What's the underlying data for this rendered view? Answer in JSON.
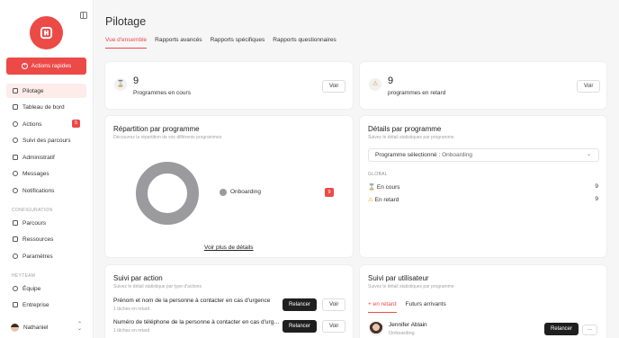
{
  "app": {
    "brand_color": "#ec4a47"
  },
  "sidebar": {
    "quick_action_label": "Actions rapides",
    "items": [
      {
        "label": "Pilotage",
        "icon": "home-icon",
        "active": true
      },
      {
        "label": "Tableau de bord",
        "icon": "dashboard-icon"
      },
      {
        "label": "Actions",
        "icon": "lightning-icon",
        "badge": "5"
      },
      {
        "label": "Suivi des parcours",
        "icon": "route-icon"
      },
      {
        "label": "Administratif",
        "icon": "folder-icon"
      },
      {
        "label": "Messages",
        "icon": "chat-icon"
      },
      {
        "label": "Notifications",
        "icon": "bell-icon"
      }
    ],
    "config_section": "CONFIGURATION",
    "config_items": [
      {
        "label": "Parcours",
        "icon": "chart-icon"
      },
      {
        "label": "Ressources",
        "icon": "database-icon"
      },
      {
        "label": "Paramètres",
        "icon": "gear-icon"
      }
    ],
    "team_section": "HEYTEAM",
    "team_items": [
      {
        "label": "Équipe",
        "icon": "user-icon"
      },
      {
        "label": "Entreprise",
        "icon": "building-icon"
      }
    ],
    "user_name": "Nathaniel"
  },
  "header": {
    "title": "Pilotage",
    "tabs": [
      "Vue d'ensemble",
      "Rapports avancés",
      "Rapports spécifiques",
      "Rapports questionnaires"
    ]
  },
  "stats": [
    {
      "value": "9",
      "label": "Programmes en cours",
      "icon": "hourglass-icon",
      "button": "Voir"
    },
    {
      "value": "9",
      "label": "programmes en retard",
      "icon": "warning-icon",
      "button": "Voir"
    }
  ],
  "repartition": {
    "title": "Répartition par programme",
    "subtitle": "Découvrez la répartition de vos différents programmes",
    "legend_label": "Onboarding",
    "legend_count": "9",
    "link": "Voir plus de détails",
    "donut_color": "#9b9b9d"
  },
  "details": {
    "title": "Détails par programme",
    "subtitle": "Suivez le détail statistiques par programme",
    "select_label": "Programme sélectionné :",
    "select_value": "Onboarding",
    "section": "GLOBAL",
    "rows": [
      {
        "label": "En cours",
        "value": "9",
        "icon": "hourglass-icon"
      },
      {
        "label": "En retard",
        "value": "9",
        "icon": "warning-icon"
      }
    ]
  },
  "suivi_action": {
    "title": "Suivi par action",
    "subtitle": "Suivez le détail statistique par type d'actions",
    "rows": [
      {
        "title": "Prénom et nom de la personne à contacter en cas d'urgence",
        "sub": "1 tâches en retard",
        "primary": "Relancer",
        "secondary": "Voir"
      },
      {
        "title": "Numéro de téléphone de la personne à contacter en cas d'urg…",
        "sub": "1 tâches en retard",
        "primary": "Relancer",
        "secondary": "Voir"
      }
    ]
  },
  "suivi_user": {
    "title": "Suivi par utilisateur",
    "subtitle": "Suivez le détail statistiques par programme",
    "tabs": [
      "+ en retard",
      "Futurs arrivants"
    ],
    "user_name": "Jennifer Ablain",
    "user_program": "Onboarding",
    "button": "Relancer",
    "more": "..."
  }
}
